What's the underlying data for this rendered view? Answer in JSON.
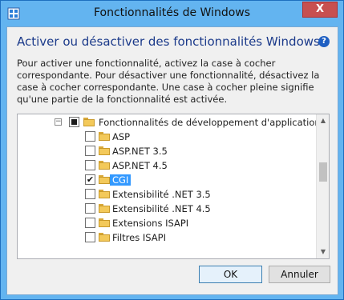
{
  "window": {
    "title": "Fonctionnalités de Windows",
    "close_label": "X"
  },
  "header": {
    "heading": "Activer ou désactiver des fonctionnalités Windows",
    "help_label": "?"
  },
  "description": "Pour activer une fonctionnalité, activez la case à cocher correspondante. Pour désactiver une fonctionnalité, désactivez la case à cocher correspondante. Une case à cocher pleine signifie qu'une partie de la fonctionnalité est activée.",
  "tree": {
    "parent": {
      "label": "Fonctionnalités de développement d'applications",
      "expander": "−",
      "state": "partial",
      "icon": "folder-icon"
    },
    "items": [
      {
        "label": "ASP",
        "state": "unchecked",
        "selected": false
      },
      {
        "label": "ASP.NET 3.5",
        "state": "unchecked",
        "selected": false
      },
      {
        "label": "ASP.NET 4.5",
        "state": "unchecked",
        "selected": false
      },
      {
        "label": "CGI",
        "state": "checked",
        "selected": true
      },
      {
        "label": "Extensibilité .NET 3.5",
        "state": "unchecked",
        "selected": false
      },
      {
        "label": "Extensibilité .NET 4.5",
        "state": "unchecked",
        "selected": false
      },
      {
        "label": "Extensions ISAPI",
        "state": "unchecked",
        "selected": false
      },
      {
        "label": "Filtres ISAPI",
        "state": "unchecked",
        "selected": false
      }
    ],
    "check_glyph": "✔"
  },
  "scrollbar": {
    "up_arrow": "▲",
    "down_arrow": "▼"
  },
  "buttons": {
    "ok": "OK",
    "cancel": "Annuler"
  },
  "colors": {
    "title_bar": "#63b4f0",
    "selection": "#3399ff",
    "heading": "#1b3a8a",
    "close_button": "#c75050"
  }
}
